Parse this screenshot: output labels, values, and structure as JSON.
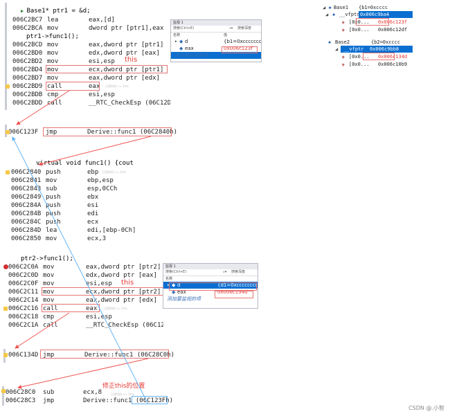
{
  "block1": {
    "source1": "Base1* ptr1 = &d;",
    "rows_a": [
      {
        "addr": "006C2BC7",
        "mn": "lea",
        "op": "eax,[d]"
      },
      {
        "addr": "006C2BCA",
        "mn": "mov",
        "op": "dword ptr [ptr1],eax"
      }
    ],
    "source2": "ptr1->func1();",
    "rows_b": [
      {
        "addr": "006C2BCD",
        "mn": "mov",
        "op": "eax,dword ptr [ptr1]"
      },
      {
        "addr": "006C2BD0",
        "mn": "mov",
        "op": "edx,dword ptr [eax]"
      },
      {
        "addr": "006C2BD2",
        "mn": "mov",
        "op": "esi,esp"
      },
      {
        "addr": "006C2BD4",
        "mn": "mov",
        "op": "ecx,dword ptr [ptr1]"
      },
      {
        "addr": "006C2BD7",
        "mn": "mov",
        "op": "eax,dword ptr [edx]"
      },
      {
        "addr": "006C2BD9",
        "mn": "call",
        "op": "eax"
      },
      {
        "addr": "006C2BDB",
        "mn": "cmp",
        "op": "esi,esp"
      },
      {
        "addr": "006C2BDD",
        "mn": "call",
        "op": "__RTC_CheckEsp (06C12D0"
      }
    ],
    "this_label": "this",
    "tip": "已用时间 <= 1ms"
  },
  "watch1": {
    "title": "监视 1",
    "search": "搜索(Ctrl+E)",
    "search_btn": "搜索深度",
    "col_name": "名称",
    "col_value": "值",
    "rows": [
      {
        "name": "d",
        "value": "{b1=0xcccccccc"
      },
      {
        "name": "eax",
        "value": "0x006c123f"
      }
    ],
    "add_hint": "添加要监视的项"
  },
  "vtable1": {
    "root": "Base1",
    "root_value": "{b1=0xcccc",
    "vfptr": "__vfptr",
    "vfptr_value": "0x006c9ba4",
    "entries": [
      {
        "name": "[0x0...",
        "value": "0x006c123f"
      },
      {
        "name": "[0x0...",
        "value": "0x006c12df"
      }
    ]
  },
  "vtable2": {
    "root": "Base2",
    "root_value": "{b2=0xcccc",
    "vfptr": "__vfptr",
    "vfptr_value": "0x006c9bb8",
    "entries": [
      {
        "name": "[0x0...",
        "value": "0x006c134d"
      },
      {
        "name": "[0x0...",
        "value": "0x006c10b9"
      }
    ]
  },
  "thunk1": {
    "addr": "006C123F",
    "mn": "jmp",
    "op": "Derive::func1 (06C2840h)"
  },
  "block2": {
    "source": "virtual void func1() {cout << \"D",
    "rows": [
      {
        "addr": "006C2840",
        "mn": "push",
        "op": "ebp"
      },
      {
        "addr": "006C2841",
        "mn": "mov",
        "op": "ebp,esp"
      },
      {
        "addr": "006C2843",
        "mn": "sub",
        "op": "esp,0CCh"
      },
      {
        "addr": "006C2849",
        "mn": "push",
        "op": "ebx"
      },
      {
        "addr": "006C284A",
        "mn": "push",
        "op": "esi"
      },
      {
        "addr": "006C284B",
        "mn": "push",
        "op": "edi"
      },
      {
        "addr": "006C284C",
        "mn": "push",
        "op": "ecx"
      },
      {
        "addr": "006C284D",
        "mn": "lea",
        "op": "edi,[ebp-0Ch]"
      },
      {
        "addr": "006C2850",
        "mn": "mov",
        "op": "ecx,3"
      }
    ],
    "tip": "已用时间 <= 1ms"
  },
  "block3": {
    "source": "ptr2->func1();",
    "rows": [
      {
        "addr": "006C2C0A",
        "mn": "mov",
        "op": "eax,dword ptr [ptr2]"
      },
      {
        "addr": "006C2C0D",
        "mn": "mov",
        "op": "edx,dword ptr [eax]"
      },
      {
        "addr": "006C2C0F",
        "mn": "mov",
        "op": "esi,esp"
      },
      {
        "addr": "006C2C11",
        "mn": "mov",
        "op": "ecx,dword ptr [ptr2]"
      },
      {
        "addr": "006C2C14",
        "mn": "mov",
        "op": "eax,dword ptr [edx]"
      },
      {
        "addr": "006C2C16",
        "mn": "call",
        "op": "eax"
      },
      {
        "addr": "006C2C18",
        "mn": "cmp",
        "op": "esi,esp"
      },
      {
        "addr": "006C2C1A",
        "mn": "call",
        "op": "__RTC_CheckEsp (06C12D"
      }
    ],
    "this_label": "this",
    "tip": "已用时间 <= 1ms"
  },
  "watch2": {
    "title": "监视 1",
    "search": "搜索(Ctrl+E)",
    "search_btn": "搜索深度",
    "col_name": "名称",
    "rows": [
      {
        "name": "d",
        "value": "{d1=0xcccccccc"
      },
      {
        "name": "eax",
        "value": "0x006c134d"
      }
    ],
    "add_hint": "添加要监视的项"
  },
  "thunk2": {
    "addr": "006C134D",
    "mn": "jmp",
    "op": "Derive::func1 (06C28C0h)"
  },
  "fix_label": "修正this的位置",
  "block4": {
    "rows": [
      {
        "addr": "006C28C0",
        "mn": "sub",
        "op": "ecx,8"
      },
      {
        "addr": "006C28C3",
        "mn": "jmp",
        "op": "Derive::func1 (06C123Fh)"
      }
    ],
    "tip": "已用时间 <= 1ms"
  },
  "watermark": "CSDN @.小智",
  "colors": {
    "highlight_box": "#e57373",
    "arrow_red": "#ef5350",
    "arrow_blue": "#64b5f6",
    "selection": "#0a6fd0"
  }
}
